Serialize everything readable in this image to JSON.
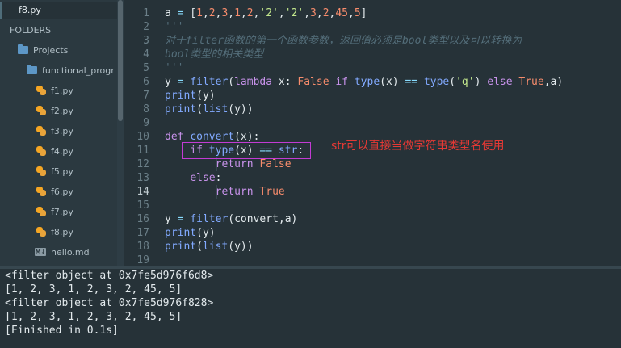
{
  "sidebar": {
    "open_file": "f8.py",
    "folders_header": "FOLDERS",
    "project": "Projects",
    "folder": "functional_progr",
    "files": [
      "f1.py",
      "f2.py",
      "f3.py",
      "f4.py",
      "f5.py",
      "f6.py",
      "f7.py",
      "f8.py",
      "hello.md"
    ],
    "md_badge": "M↓"
  },
  "editor": {
    "line_numbers": [
      "1",
      "2",
      "3",
      "4",
      "5",
      "6",
      "7",
      "8",
      "9",
      "10",
      "11",
      "12",
      "13",
      "14",
      "15",
      "16",
      "17",
      "18",
      "19"
    ],
    "active_line": "14",
    "lines": [
      "a = [1,2,3,1,2,'2','2',3,2,45,5]",
      "'''",
      "对于filter函数的第一个函数参数，返回值必须是bool类型以及可以转换为",
      "bool类型的相关类型",
      "'''",
      "y = filter(lambda x: False if type(x) == type('q') else True,a)",
      "print(y)",
      "print(list(y))",
      "",
      "def convert(x):",
      "    if type(x) == str:",
      "        return False",
      "    else:",
      "        return True",
      "",
      "y = filter(convert,a)",
      "print(y)",
      "print(list(y))",
      ""
    ],
    "annotation": "str可以直接当做字符串类型名使用"
  },
  "output": {
    "lines": [
      "<filter object at 0x7fe5d976f6d8>",
      "[1, 2, 3, 1, 2, 3, 2, 45, 5]",
      "<filter object at 0x7fe5d976f828>",
      "[1, 2, 3, 1, 2, 3, 2, 45, 5]",
      "[Finished in 0.1s]"
    ]
  }
}
